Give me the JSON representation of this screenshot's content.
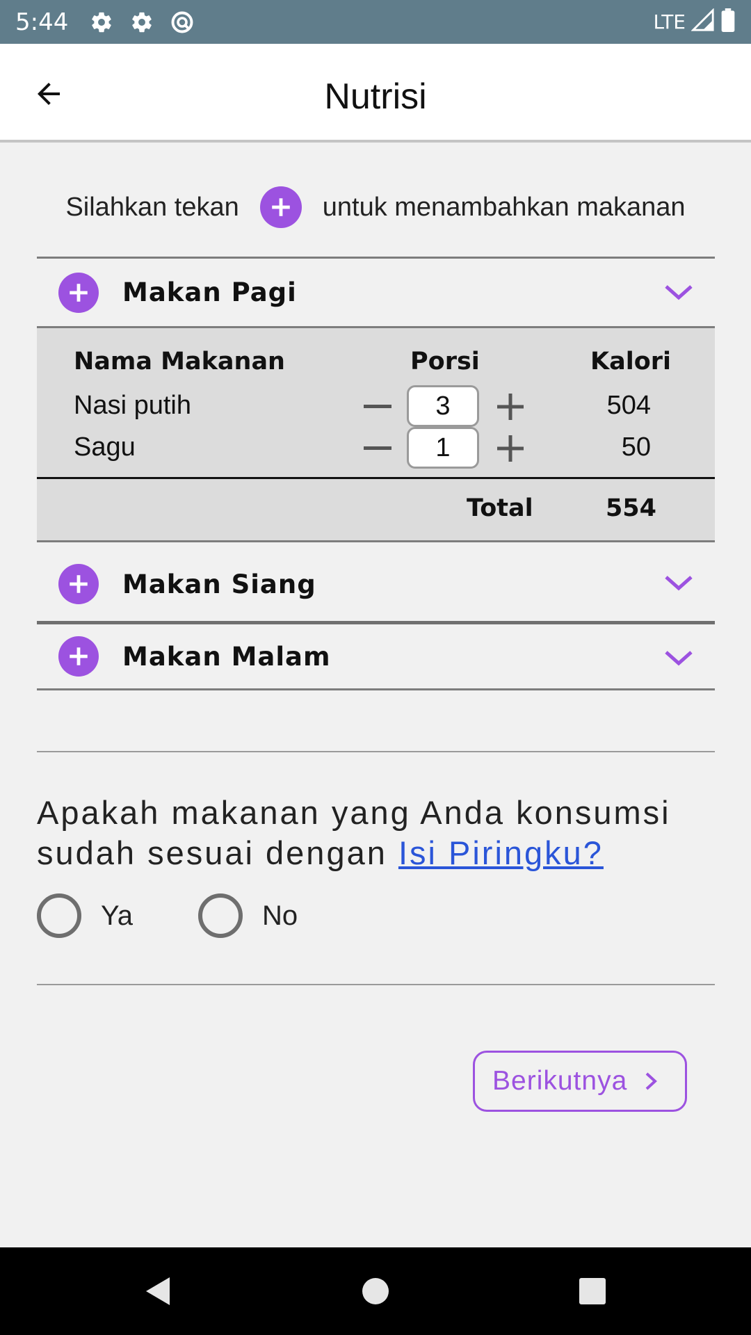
{
  "status_bar": {
    "time": "5:44",
    "network": "LTE",
    "icons": [
      "gear-icon",
      "gear-icon",
      "data-saver-icon",
      "signal-icon",
      "battery-icon"
    ]
  },
  "app_bar": {
    "title": "Nutrisi",
    "back_icon": "arrow-left-icon"
  },
  "instruction": {
    "before": "Silahkan tekan",
    "after": "untuk menambahkan makanan"
  },
  "meals": [
    {
      "name": "Makan Pagi",
      "expanded": true,
      "columns": [
        "Nama Makanan",
        "Porsi",
        "Kalori"
      ],
      "items": [
        {
          "name": "Nasi putih",
          "portion": "3",
          "calories": "504"
        },
        {
          "name": "Sagu",
          "portion": "1",
          "calories": "50"
        }
      ],
      "total_label": "Total",
      "total_value": "554"
    },
    {
      "name": "Makan Siang",
      "expanded": false
    },
    {
      "name": "Makan Malam",
      "expanded": false
    }
  ],
  "question": {
    "text": "Apakah makanan yang Anda konsumsi sudah sesuai dengan",
    "link": "Isi Piringku?",
    "options": [
      "Ya",
      "No"
    ]
  },
  "next_button": {
    "label": "Berikutnya"
  },
  "colors": {
    "status_bar": "#607d8b",
    "accent": "#9c52e0",
    "link": "#2a55d8",
    "table_bg": "#dcdcdc",
    "page_bg": "#f1f1f1"
  }
}
